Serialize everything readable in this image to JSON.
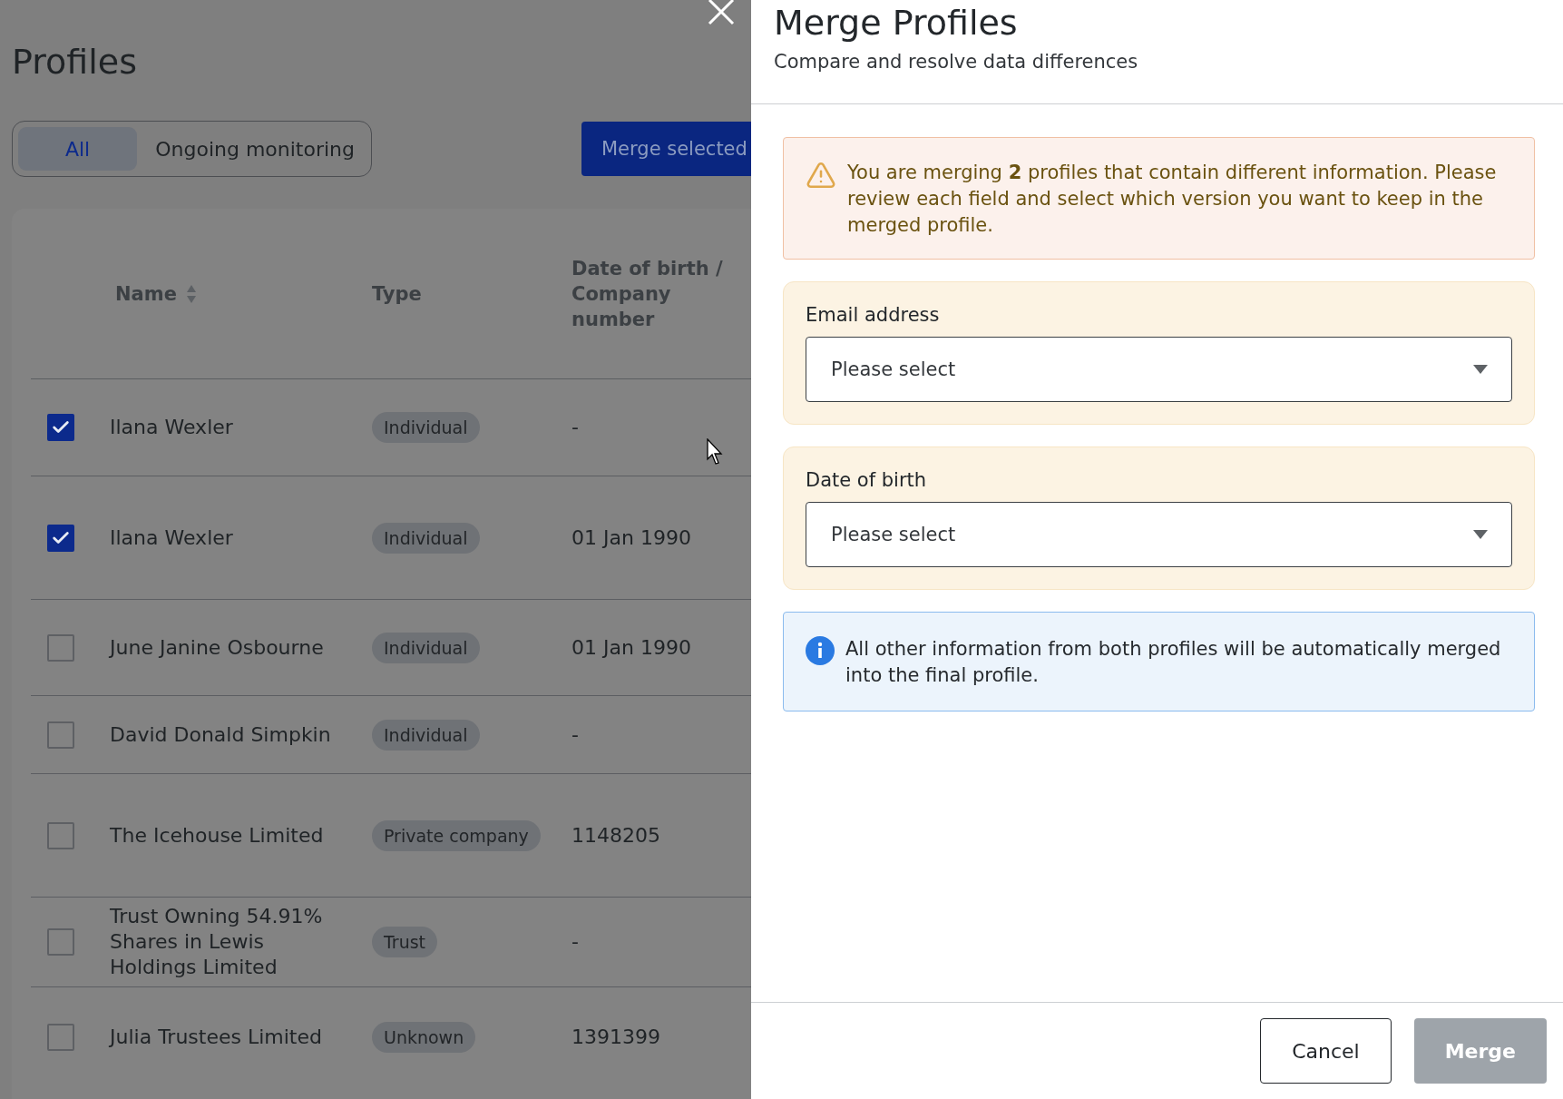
{
  "page": {
    "title": "Profiles",
    "filter_tabs": [
      {
        "label": "All",
        "selected": true
      },
      {
        "label": "Ongoing monitoring",
        "selected": false
      }
    ],
    "merge_button": "Merge selected",
    "table": {
      "columns": [
        "Name",
        "Type",
        "Date of birth / Company number"
      ],
      "rows": [
        {
          "checked": true,
          "name": "Ilana Wexler",
          "type": "Individual",
          "dob_or_number": "-"
        },
        {
          "checked": true,
          "name": "Ilana Wexler",
          "type": "Individual",
          "dob_or_number": "01 Jan 1990"
        },
        {
          "checked": false,
          "name": "June Janine Osbourne",
          "type": "Individual",
          "dob_or_number": "01 Jan 1990"
        },
        {
          "checked": false,
          "name": "David Donald Simpkin",
          "type": "Individual",
          "dob_or_number": "-"
        },
        {
          "checked": false,
          "name": "The Icehouse Limited",
          "type": "Private company",
          "dob_or_number": "1148205"
        },
        {
          "checked": false,
          "name": "Trust Owning 54.91% Shares in Lewis Holdings Limited",
          "type": "Trust",
          "dob_or_number": "-"
        },
        {
          "checked": false,
          "name": "Julia Trustees Limited",
          "type": "Unknown",
          "dob_or_number": "1391399"
        }
      ]
    }
  },
  "dialog": {
    "title": "Merge Profiles",
    "subtitle": "Compare and resolve data differences",
    "warning": "You are merging **2** profiles that contain different information. Please review each field and select which version you want to keep in the merged profile.",
    "fields": [
      {
        "label": "Email address",
        "placeholder": "Please select"
      },
      {
        "label": "Date of birth",
        "placeholder": "Please select"
      }
    ],
    "info": "All other information from both profiles will be automatically merged into the final profile.",
    "buttons": [
      {
        "label": "Cancel",
        "kind": "secondary"
      },
      {
        "label": "Merge",
        "kind": "primary",
        "disabled": true
      }
    ]
  }
}
